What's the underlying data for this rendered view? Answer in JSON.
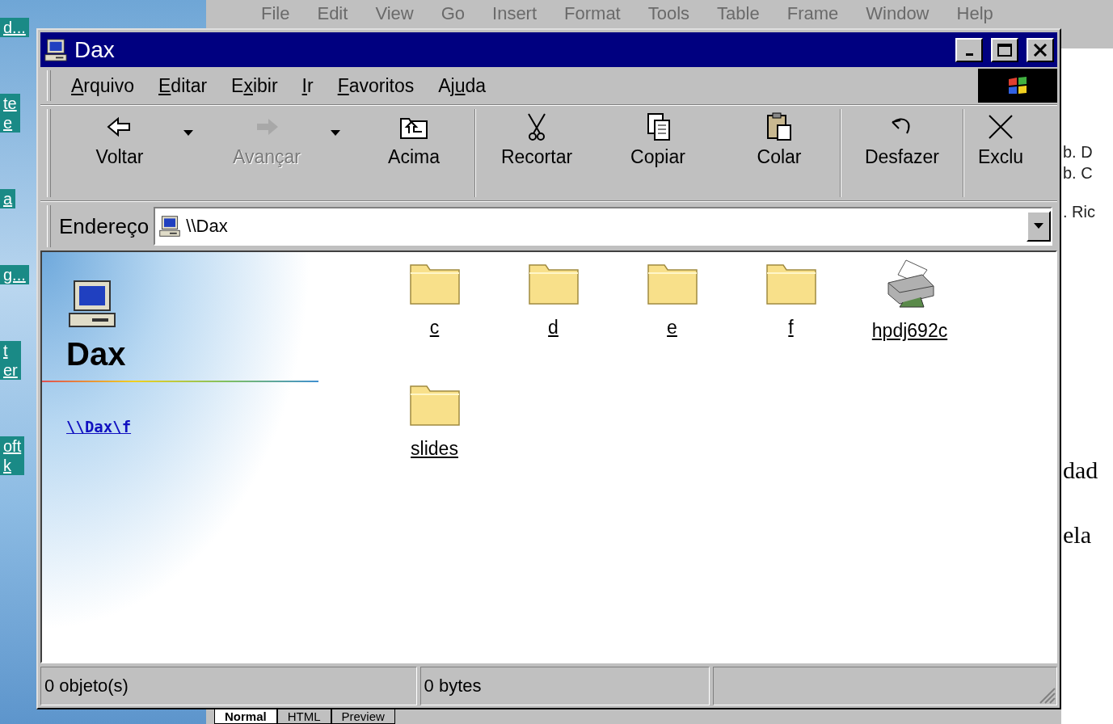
{
  "desktop": {
    "icon_labels": [
      [
        "d..."
      ],
      [
        "te",
        "e"
      ],
      [
        "a"
      ],
      [
        "g..."
      ],
      [
        "t",
        "er"
      ],
      [
        "oft",
        "k"
      ]
    ]
  },
  "background_app": {
    "menu": [
      "File",
      "Edit",
      "View",
      "Go",
      "Insert",
      "Format",
      "Tools",
      "Table",
      "Frame",
      "Window",
      "Help"
    ],
    "side_texts": [
      "b. D",
      "b. C",
      ". Ric"
    ],
    "body_texts": [
      "dad",
      "ela"
    ],
    "view_tabs": [
      {
        "label": "Normal",
        "selected": true
      },
      {
        "label": "HTML",
        "selected": false
      },
      {
        "label": "Preview",
        "selected": false
      }
    ]
  },
  "window": {
    "title": "Dax",
    "menu": [
      {
        "key": "A",
        "after": "rquivo"
      },
      {
        "key": "E",
        "after": "ditar"
      },
      {
        "before": "E",
        "key": "x",
        "after": "ibir"
      },
      {
        "key": "I",
        "after": "r"
      },
      {
        "key": "F",
        "after": "avoritos"
      },
      {
        "before": "Aj",
        "key": "u",
        "after": "da"
      }
    ],
    "toolbar": [
      {
        "label": "Voltar",
        "kind": "back",
        "disabled": false,
        "dropdown": true,
        "separator_before": false
      },
      {
        "label": "Avançar",
        "kind": "forward",
        "disabled": true,
        "dropdown": true,
        "separator_before": false
      },
      {
        "label": "Acima",
        "kind": "up",
        "disabled": false,
        "dropdown": false,
        "separator_before": false
      },
      {
        "label": "Recortar",
        "kind": "cut",
        "disabled": false,
        "dropdown": false,
        "separator_before": true
      },
      {
        "label": "Copiar",
        "kind": "copy",
        "disabled": false,
        "dropdown": false,
        "separator_before": false
      },
      {
        "label": "Colar",
        "kind": "paste",
        "disabled": false,
        "dropdown": false,
        "separator_before": false
      },
      {
        "label": "Desfazer",
        "kind": "undo",
        "disabled": false,
        "dropdown": false,
        "separator_before": true
      },
      {
        "label": "Exclu",
        "kind": "delete",
        "disabled": false,
        "dropdown": false,
        "separator_before": true
      }
    ],
    "address": {
      "label": "Endereço",
      "value": "\\\\Dax"
    },
    "sidebar": {
      "title": "Dax",
      "link": "\\\\Dax\\f"
    },
    "items": [
      {
        "name": "c",
        "kind": "folder"
      },
      {
        "name": "d",
        "kind": "folder"
      },
      {
        "name": "e",
        "kind": "folder"
      },
      {
        "name": "f",
        "kind": "folder"
      },
      {
        "name": "hpdj692c",
        "kind": "printer"
      },
      {
        "name": "slides",
        "kind": "folder"
      }
    ],
    "status_bar": [
      "0 objeto(s)",
      "0 bytes"
    ]
  }
}
